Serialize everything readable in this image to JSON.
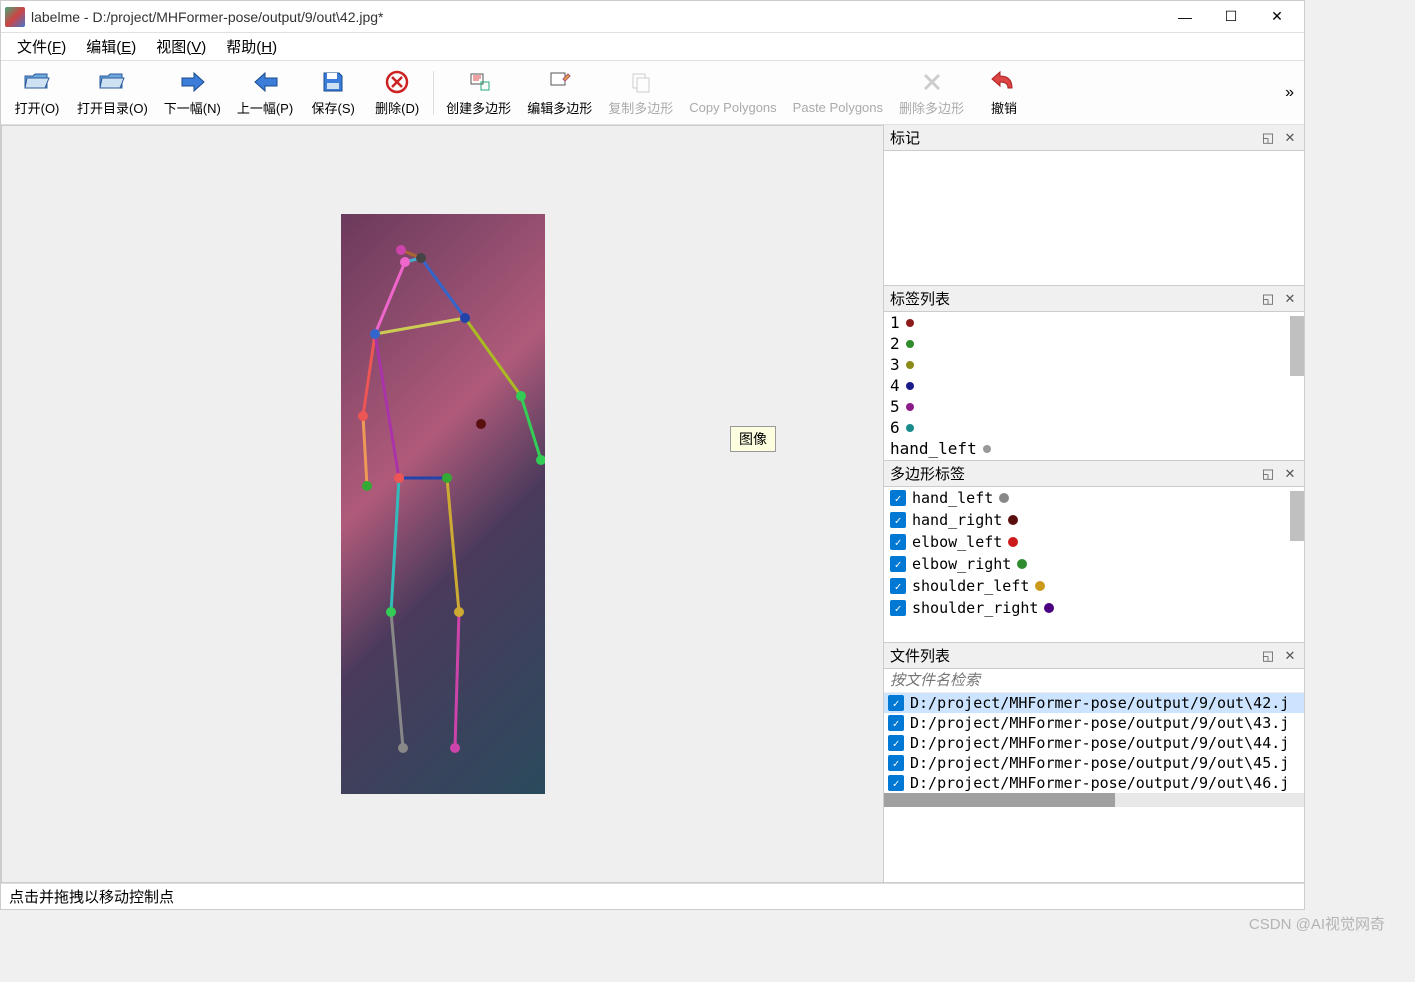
{
  "titlebar": {
    "text": "labelme - D:/project/MHFormer-pose/output/9/out\\42.jpg*"
  },
  "menu": {
    "file": "文件",
    "file_u": "F",
    "edit": "编辑",
    "edit_u": "E",
    "view": "视图",
    "view_u": "V",
    "help": "帮助",
    "help_u": "H"
  },
  "toolbar": {
    "open": "打开(O)",
    "open_dir": "打开目录(O)",
    "next": "下一幅(N)",
    "prev": "上一幅(P)",
    "save": "保存(S)",
    "delete": "删除(D)",
    "create_poly": "创建多边形",
    "edit_poly": "编辑多边形",
    "copy_poly": "复制多边形",
    "copy_polygons": "Copy Polygons",
    "paste_polygons": "Paste Polygons",
    "delete_poly": "删除多边形",
    "undo": "撤销"
  },
  "hover": "图像",
  "panels": {
    "marks": "标记",
    "labels": "标签列表",
    "polys": "多边形标签",
    "files": "文件列表",
    "search_placeholder": "按文件名检索"
  },
  "label_list": [
    {
      "name": "1",
      "color": "#8b1a1a"
    },
    {
      "name": "2",
      "color": "#2e8b2e"
    },
    {
      "name": "3",
      "color": "#8b8b1a"
    },
    {
      "name": "4",
      "color": "#1a1a8b"
    },
    {
      "name": "5",
      "color": "#8b1a8b"
    },
    {
      "name": "6",
      "color": "#1a8b8b"
    },
    {
      "name": "hand_left",
      "color": "#999999"
    }
  ],
  "poly_labels": [
    {
      "name": "hand_left",
      "color": "#888888"
    },
    {
      "name": "hand_right",
      "color": "#5a0f0f"
    },
    {
      "name": "elbow_left",
      "color": "#cc1a1a"
    },
    {
      "name": "elbow_right",
      "color": "#2e8b2e"
    },
    {
      "name": "shoulder_left",
      "color": "#cc9a1a"
    },
    {
      "name": "shoulder_right",
      "color": "#4b0082"
    }
  ],
  "file_list": [
    {
      "path": "D:/project/MHFormer-pose/output/9/out\\42.j",
      "selected": true
    },
    {
      "path": "D:/project/MHFormer-pose/output/9/out\\43.j",
      "selected": false
    },
    {
      "path": "D:/project/MHFormer-pose/output/9/out\\44.j",
      "selected": false
    },
    {
      "path": "D:/project/MHFormer-pose/output/9/out\\45.j",
      "selected": false
    },
    {
      "path": "D:/project/MHFormer-pose/output/9/out\\46.j",
      "selected": false
    }
  ],
  "statusbar": "点击并拖拽以移动控制点",
  "watermark": "CSDN @AI视觉网奇"
}
